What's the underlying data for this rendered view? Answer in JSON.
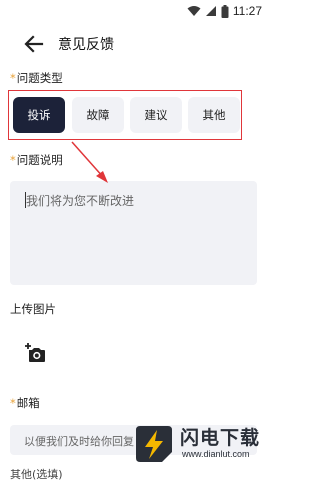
{
  "status_bar": {
    "time": "11:27",
    "icons": [
      "wifi-icon",
      "signal-icon",
      "battery-icon"
    ]
  },
  "header": {
    "title": "意见反馈",
    "back_icon": "back-arrow-icon"
  },
  "issue_type": {
    "label": "问题类型",
    "required_mark": "*",
    "options": [
      {
        "label": "投诉",
        "selected": true
      },
      {
        "label": "故障",
        "selected": false
      },
      {
        "label": "建议",
        "selected": false
      },
      {
        "label": "其他",
        "selected": false
      }
    ]
  },
  "description": {
    "label": "问题说明",
    "required_mark": "*",
    "placeholder": "我们将为您不断改进"
  },
  "upload": {
    "label": "上传图片",
    "icon": "add-photo-icon"
  },
  "email": {
    "label": "邮箱",
    "required_mark": "*",
    "placeholder": "以便我们及时给你回复"
  },
  "next_section": {
    "label": "其他(选填)"
  },
  "watermark": {
    "text": "闪电下载",
    "url": "www.dianlut.com"
  },
  "colors": {
    "accent_dark": "#1c2239",
    "annotation_red": "#e0363a",
    "required": "#e8a33a",
    "field_bg": "#f1f2f6"
  }
}
